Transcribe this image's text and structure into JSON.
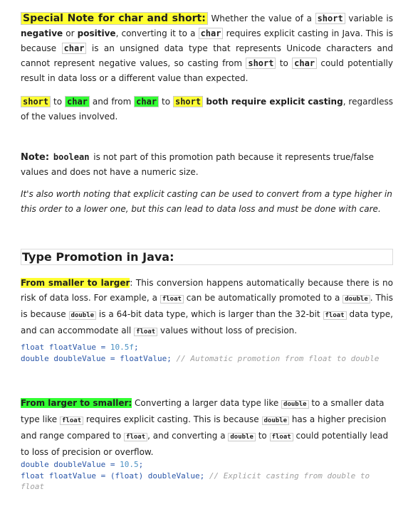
{
  "note1": {
    "title": "Special Note for char and short:",
    "t1": " Whether the value of a ",
    "short": "short",
    "t2": " variable is ",
    "negative": "negative",
    "t3": " or ",
    "positive": "positive",
    "t4": ", converting it to a ",
    "char": "char",
    "t5": " requires explicit casting in Java. This is because ",
    "t6": " is an unsigned data type that represents Unicode characters and cannot represent negative values, so casting from ",
    "t7": " to ",
    "t8": " could potentially result in data loss or a different value than expected."
  },
  "note2": {
    "short": "short",
    "to": " to ",
    "char": "char",
    "and_from": " and from ",
    "both": " both require explicit casting",
    "rest": ", regardless of the values involved."
  },
  "note3": {
    "label": "Note:",
    "boolean": "boolean",
    "text": " is not part of this promotion path because it represents true/false values and does not have a numeric size."
  },
  "italic_note": "It's also worth noting that explicit casting can be used to convert from a type higher in this order to a lower one, but this can lead to data loss and must be done with care.",
  "heading": "Type Promotion in Java:",
  "section1": {
    "label": "From smaller to larger",
    "colon": ":",
    "t1": " This conversion happens automatically because there is no risk of data loss. For example, a ",
    "float": "float",
    "t2": " can be automatically promoted to a ",
    "double": "double",
    "t3": ". This is because ",
    "t4": " is a 64-bit data type, which is larger than the 32-bit ",
    "t5": " data type, and can accommodate all ",
    "t6": " values without loss of precision."
  },
  "code1": {
    "l1_decl": "float floatValue = ",
    "l1_num": "10.5f",
    "l1_end": ";",
    "l2_decl": "double doubleValue = floatValue; ",
    "l2_comment": "// Automatic promotion from float to double"
  },
  "section2": {
    "label": "From larger to smaller:",
    "t1": " Converting a larger data type like ",
    "double": "double",
    "t2": " to a smaller data type like ",
    "float": "float",
    "t3": " requires explicit casting. This is because ",
    "t4": " has a higher precision and range compared to ",
    "t5": ", and converting a ",
    "t6": " to ",
    "t7": " could potentially lead to loss of precision or overflow."
  },
  "code2": {
    "l1_decl": "double doubleValue = ",
    "l1_num": "10.5",
    "l1_end": ";",
    "l2_decl": "float floatValue = (float) doubleValue; ",
    "l2_comment": "// Explicit casting from double to float"
  }
}
